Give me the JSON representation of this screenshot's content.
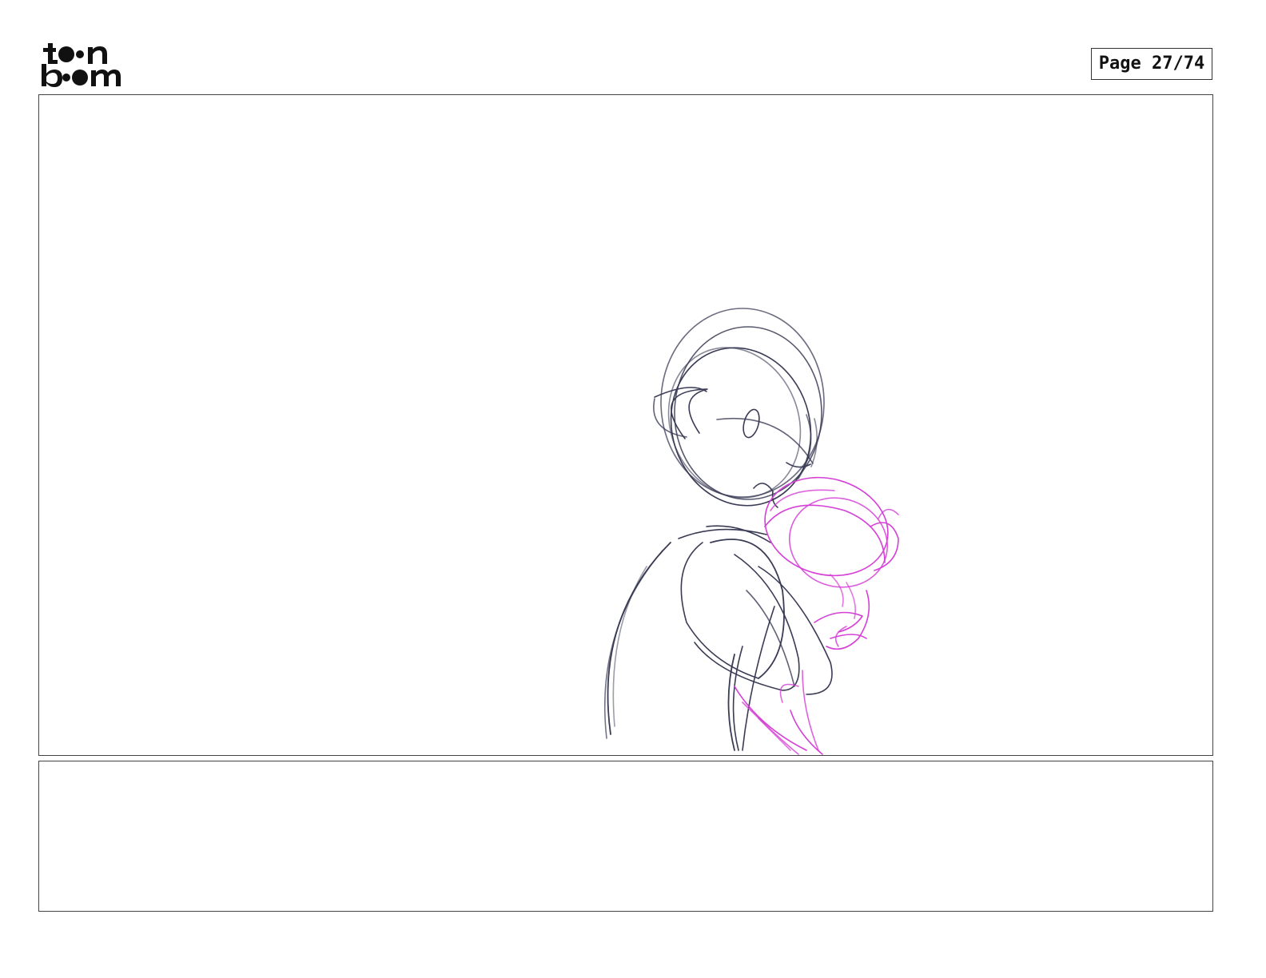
{
  "header": {
    "logo_line1": "toon",
    "logo_line2": "boom",
    "page_indicator": "Page 27/74"
  },
  "panel": {
    "sketch_colors": {
      "character_lines": "#3a3b55",
      "character_lines_light": "#8a8ca3",
      "secondary_figure": "#d53fd6"
    }
  },
  "notes": {
    "text": ""
  }
}
